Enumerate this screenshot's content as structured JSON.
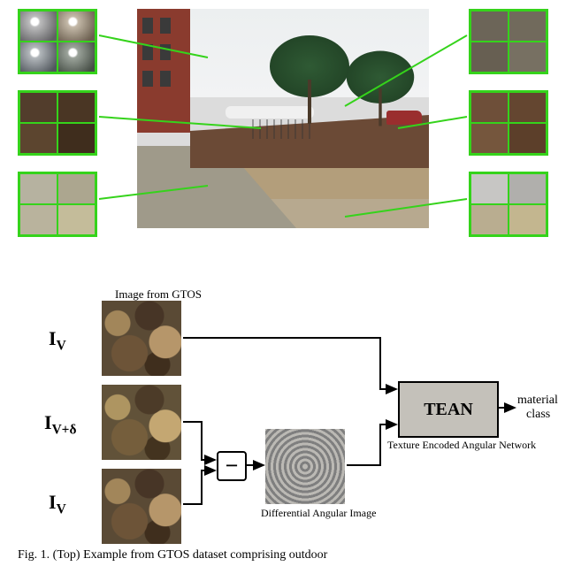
{
  "top_label": "Image from GTOS",
  "Iv": "I",
  "Iv_sub": "V",
  "Ivd": "I",
  "Ivd_sub": "V+δ",
  "Iv2": "I",
  "Iv2_sub": "V",
  "diff_label": "Differential Angular Image",
  "tean": "TEAN",
  "tean_sub": "Texture Encoded Angular Network",
  "out1": "material",
  "out2": "class",
  "caption": "Fig. 1. (Top) Example from GTOS dataset comprising outdoor"
}
